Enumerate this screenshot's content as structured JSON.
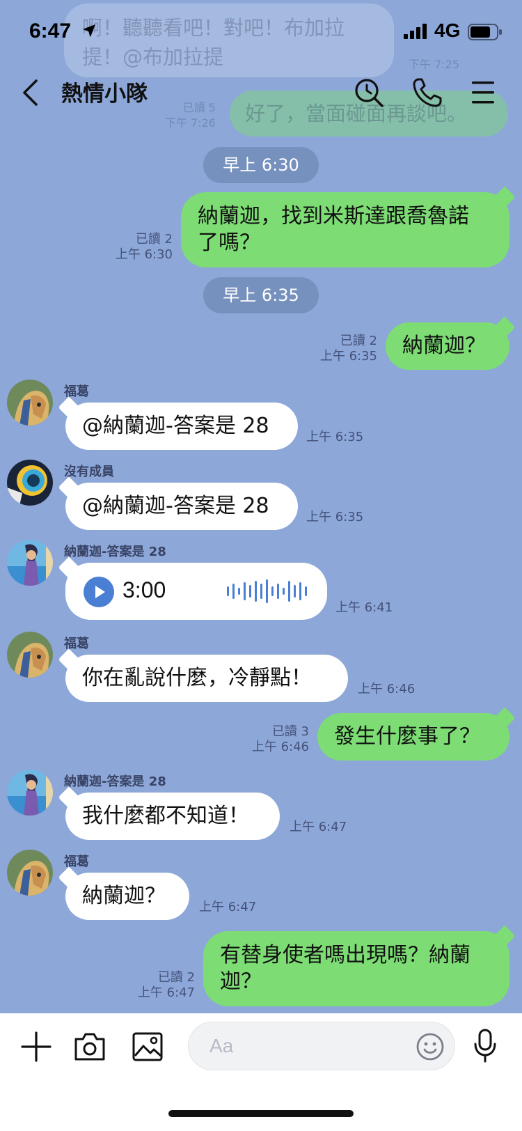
{
  "status_bar": {
    "time": "6:47",
    "network": "4G"
  },
  "header": {
    "title": "熱情小隊"
  },
  "ghost": {
    "bubble_1": "啊！聽聽看吧！對吧！布加拉提！@布加拉提",
    "bubble_1_line1": "啊！聽聽看吧！對吧！布加拉",
    "bubble_1_line2": "提！@布加拉提",
    "time_1": "下午 7:25",
    "read_2": "已讀 5",
    "time_2": "下午 7:26",
    "bubble_2": "好了，當面碰面再談吧。"
  },
  "messages": [
    {
      "type": "date",
      "text": "早上 6:30"
    },
    {
      "type": "me",
      "line1": "納蘭迦，找到米斯達跟喬魯諾",
      "line2": "了嗎？",
      "read": "已讀 2",
      "time": "上午 6:30"
    },
    {
      "type": "date",
      "text": "早上 6:35"
    },
    {
      "type": "me",
      "line1": "納蘭迦？",
      "read": "已讀 2",
      "time": "上午 6:35"
    },
    {
      "type": "them",
      "sender": "福葛",
      "line1": "@納蘭迦-答案是 28",
      "time": "上午 6:35"
    },
    {
      "type": "them",
      "sender": "沒有成員",
      "line1": "@納蘭迦-答案是 28",
      "time": "上午 6:35"
    },
    {
      "type": "voice",
      "sender": "納蘭迦-答案是 28",
      "duration": "3:00",
      "time": "上午 6:41"
    },
    {
      "type": "them",
      "sender": "福葛",
      "line1": "你在亂說什麼，冷靜點！",
      "time": "上午 6:46"
    },
    {
      "type": "me",
      "line1": "發生什麼事了？",
      "read": "已讀 3",
      "time": "上午 6:46"
    },
    {
      "type": "them",
      "sender": "納蘭迦-答案是 28",
      "line1": "我什麼都不知道！",
      "time": "上午 6:47"
    },
    {
      "type": "them",
      "sender": "福葛",
      "line1": "納蘭迦？",
      "time": "上午 6:47"
    },
    {
      "type": "me",
      "line1": "有替身使者嗎出現嗎？納蘭",
      "line2": "迦？",
      "read": "已讀 2",
      "time": "上午 6:47"
    }
  ],
  "input": {
    "placeholder": "Aa",
    "value": ""
  },
  "colors": {
    "background": "#8ca7d8",
    "my_bubble": "#7ddd74",
    "their_bubble": "#ffffff",
    "voice_accent": "#4a7fd3"
  },
  "icons": {
    "header": [
      "back-icon",
      "search-icon",
      "phone-icon",
      "menu-icon"
    ],
    "input_bar": [
      "plus-icon",
      "camera-icon",
      "image-icon",
      "emoji-icon",
      "microphone-icon"
    ]
  }
}
